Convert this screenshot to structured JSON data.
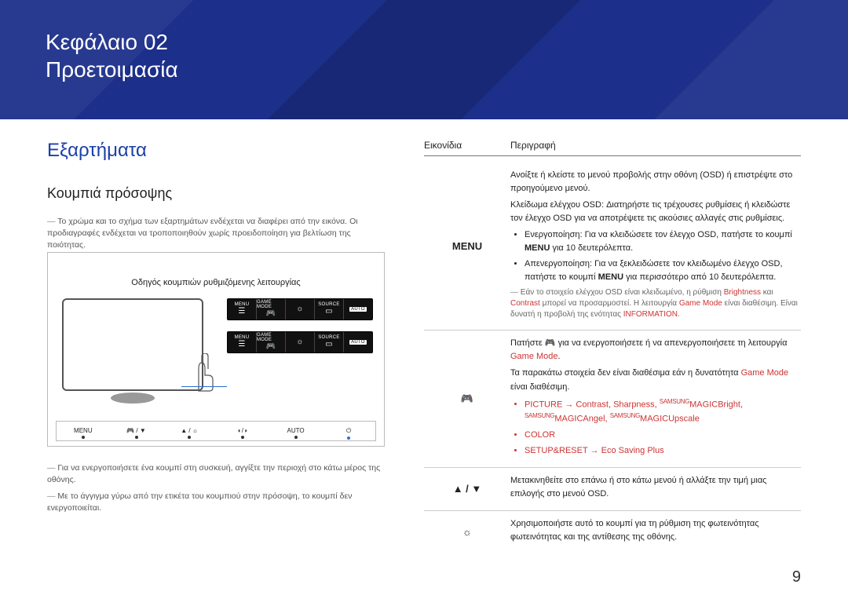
{
  "header": {
    "chapter": "Κεφάλαιο 02",
    "title": "Προετοιμασία"
  },
  "left": {
    "section_title": "Εξαρτήματα",
    "subsection_title": "Κουμπιά πρόσοψης",
    "spec_note": "Το χρώμα και το σχήμα των εξαρτημάτων ενδέχεται να διαφέρει από την εικόνα. Οι προδιαγραφές ενδέχεται να τροποποιηθούν χωρίς προειδοποίηση για βελτίωση της ποιότητας.",
    "guide_caption": "Οδηγός κουμπιών ρυθμιζόμενης λειτουργίας",
    "strip_labels": {
      "menu": "MENU",
      "game": "GAME MODE",
      "bright": "☼",
      "source": "SOURCE",
      "auto": "AUTO"
    },
    "button_row": {
      "menu": "MENU",
      "game": "🎮 / ▼",
      "bright": "▲ / ☼",
      "eye": "◐/◑",
      "auto": "AUTO",
      "power": "⏻"
    },
    "footnote1": "Για να ενεργοποιήσετε ένα κουμπί στη συσκευή, αγγίξτε την περιοχή στο κάτω μέρος της οθόνης.",
    "footnote2": "Με το άγγιγμα γύρω από την ετικέτα του κουμπιού στην πρόσοψη, το κουμπί δεν ενεργοποιείται."
  },
  "right": {
    "head_icon": "Εικονίδια",
    "head_desc": "Περιγραφή",
    "rows": {
      "menu": {
        "icon_text": "MENU",
        "p1": "Ανοίξτε ή κλείστε το μενού προβολής στην οθόνη (OSD) ή επιστρέψτε στο προηγούμενο μενού.",
        "p2": "Κλείδωμα ελέγχου OSD: Διατηρήστε τις τρέχουσες ρυθμίσεις ή κλειδώστε τον έλεγχο OSD για να αποτρέψετε τις ακούσιες αλλαγές στις ρυθμίσεις.",
        "li1a": "Ενεργοποίηση: Για να κλειδώσετε τον έλεγχο OSD, πατήστε το κουμπί ",
        "li1b": " για 10 δευτερόλεπτα.",
        "li2a": "Απενεργοποίηση: Για να ξεκλειδώσετε τον κλειδωμένο έλεγχο OSD, πατήστε το κουμπί ",
        "li2b": " για περισσότερο από 10 δευτερόλεπτα.",
        "note1a": "Εάν το στοιχείο ελέγχου OSD είναι κλειδωμένο, η ρύθμιση ",
        "brightness": "Brightness",
        "note1b": " και ",
        "contrast": "Contrast",
        "note1c": " μπορεί να προσαρμοστεί. Η λειτουργία ",
        "gamemode": "Game Mode",
        "note1d": " είναι διαθέσιμη. Είναι δυνατή η προβολή της ενότητας ",
        "information": "INFORMATION",
        "note1e": "."
      },
      "game": {
        "p1a": "Πατήστε 🎮 για να ενεργοποιήσετε ή να απενεργοποιήσετε τη λειτουργία ",
        "gm": "Game Mode",
        "p1b": ".",
        "p2a": "Τα παρακάτω στοιχεία δεν είναι διαθέσιμα εάν η δυνατότητα ",
        "p2b": " είναι διαθέσιμη.",
        "li_picture": "PICTURE",
        "li_picture_tail": " → Contrast, Sharpness, ",
        "magic_bright": "Bright",
        "magic_angel": "Angel",
        "magic_upscale": "Upscale",
        "li_color": "COLOR",
        "li_setup": "SETUP&RESET",
        "li_setup_tail": " → Eco Saving Plus"
      },
      "updown": {
        "icon": "▲ / ▼",
        "desc": "Μετακινηθείτε στο επάνω ή στο κάτω μενού ή αλλάξτε την τιμή μιας επιλογής στο μενού OSD."
      },
      "sun": {
        "icon": "☼",
        "desc": "Χρησιμοποιήστε αυτό το κουμπί για τη ρύθμιση της φωτεινότητας φωτεινότητας και της αντίθεσης της οθόνης."
      }
    }
  },
  "page_number": "9"
}
